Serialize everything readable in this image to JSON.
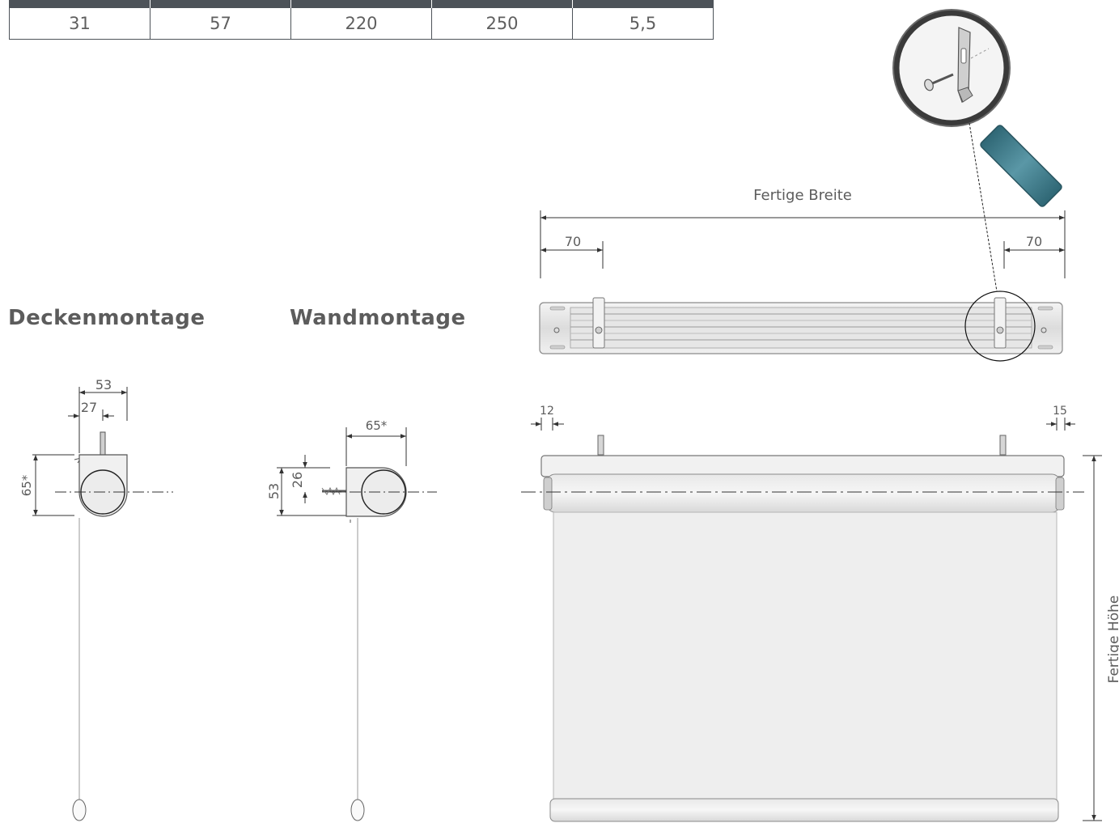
{
  "table": {
    "values": [
      "31",
      "57",
      "220",
      "250",
      "5,5"
    ]
  },
  "headings": {
    "ceiling": "Deckenmontage",
    "wall": "Wandmontage"
  },
  "ceiling_drawing": {
    "dim_width": "53",
    "dim_offset": "27",
    "dim_height": "65*"
  },
  "wall_drawing": {
    "dim_depth": "65*",
    "dim_height": "53",
    "dim_offset": "26"
  },
  "top_view": {
    "label_width": "Fertige Breite",
    "dim_left_bracket": "70",
    "dim_right_bracket": "70"
  },
  "front_view": {
    "dim_left": "12",
    "dim_right": "15",
    "label_height": "Fertige Höhe"
  },
  "colors": {
    "table_header": "#4d5359",
    "line": "#333333",
    "handle": "#3e7c8c"
  }
}
